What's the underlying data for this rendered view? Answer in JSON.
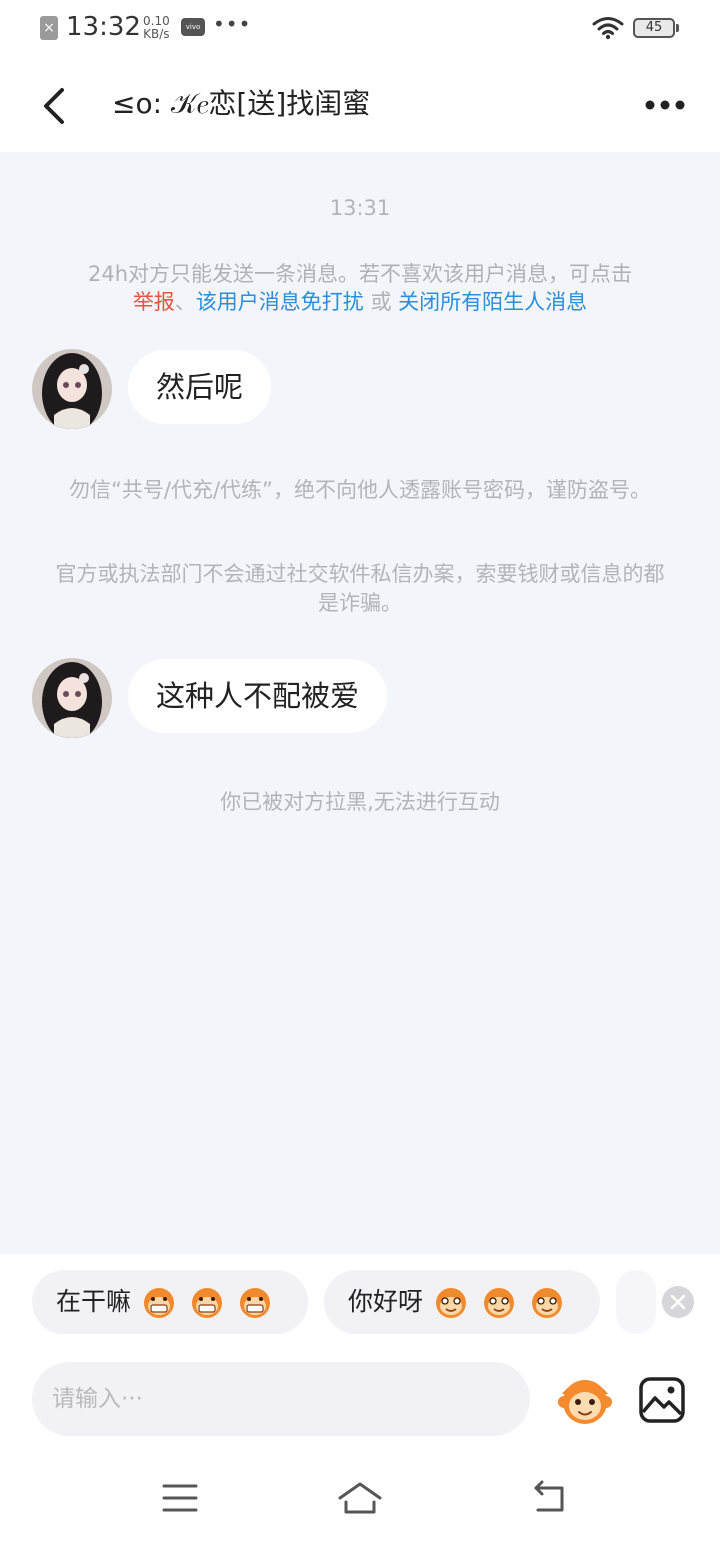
{
  "status_bar": {
    "time": "13:32",
    "speed_value": "0.10",
    "speed_unit": "KB/s",
    "carrier_badge": "vivo",
    "battery": "45"
  },
  "header": {
    "title": "≤o: 𝒦𝑒恋[送]找闺蜜"
  },
  "chat": {
    "timestamp": "13:31",
    "stranger_notice": {
      "text": "24h对方只能发送一条消息。若不喜欢该用户消息，可点击",
      "report": "举报",
      "sep1": "、",
      "dnd": "该用户消息免打扰",
      "or": " 或 ",
      "close_all": "关闭所有陌生人消息"
    },
    "messages": [
      {
        "text": "然后呢"
      },
      {
        "text": "这种人不配被爱"
      }
    ],
    "warning_1": "勿信“共号/代充/代练”，绝不向他人透露账号密码，谨防盗号。",
    "warning_2": "官方或执法部门不会通过社交软件私信办案，索要钱财或信息的都是诈骗。",
    "blocked_notice": "你已被对方拉黑,无法进行互动"
  },
  "quick_replies": [
    {
      "text": "在干嘛",
      "emoji": "grin-monkey-icon"
    },
    {
      "text": "你好呀",
      "emoji": "smile-monkey-icon"
    }
  ],
  "input": {
    "placeholder": "请输入···"
  },
  "colors": {
    "background": "#f4f5fa",
    "link_red": "#e8533f",
    "link_blue": "#2a8fd8",
    "muted_text": "#b0b0b6"
  }
}
